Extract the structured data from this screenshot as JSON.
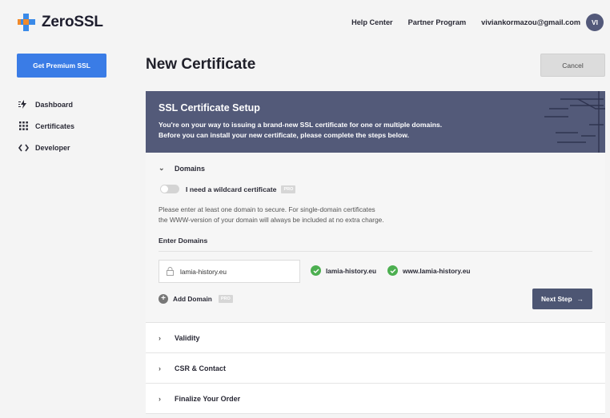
{
  "brand": {
    "name": "ZeroSSL"
  },
  "topnav": {
    "help_center": "Help Center",
    "partner_program": "Partner Program",
    "user_email": "viviankormazou@gmail.com",
    "avatar_initials": "VI"
  },
  "sidebar": {
    "premium_button": "Get Premium SSL",
    "items": [
      {
        "label": "Dashboard",
        "icon": "dashboard-icon"
      },
      {
        "label": "Certificates",
        "icon": "certificates-grid-icon"
      },
      {
        "label": "Developer",
        "icon": "code-brackets-icon"
      }
    ]
  },
  "page": {
    "title": "New Certificate",
    "cancel_label": "Cancel"
  },
  "setup": {
    "title": "SSL Certificate Setup",
    "desc_line1": "You're on your way to issuing a brand-new SSL certificate for one or multiple domains.",
    "desc_line2": "Before you can install your new certificate, please complete the steps below."
  },
  "domains": {
    "section_label": "Domains",
    "wildcard_label": "I need a wildcard certificate",
    "pro_badge": "PRO",
    "wildcard_enabled": false,
    "info_line1": "Please enter at least one domain to secure. For single-domain certificates",
    "info_line2": "the WWW-version of your domain will always be included at no extra charge.",
    "enter_label": "Enter Domains",
    "input_value": "lamia-history.eu",
    "verified": [
      "lamia-history.eu",
      "www.lamia-history.eu"
    ],
    "add_domain_label": "Add Domain",
    "next_step_label": "Next Step"
  },
  "steps": [
    {
      "label": "Validity"
    },
    {
      "label": "CSR & Contact"
    },
    {
      "label": "Finalize Your Order"
    }
  ],
  "colors": {
    "accent_blue": "#3a7ce6",
    "header_slate": "#535a79",
    "brand_blue": "#3a8ae8",
    "brand_orange": "#f08a2c",
    "success_green": "#4caf50",
    "next_button": "#4d5673"
  }
}
